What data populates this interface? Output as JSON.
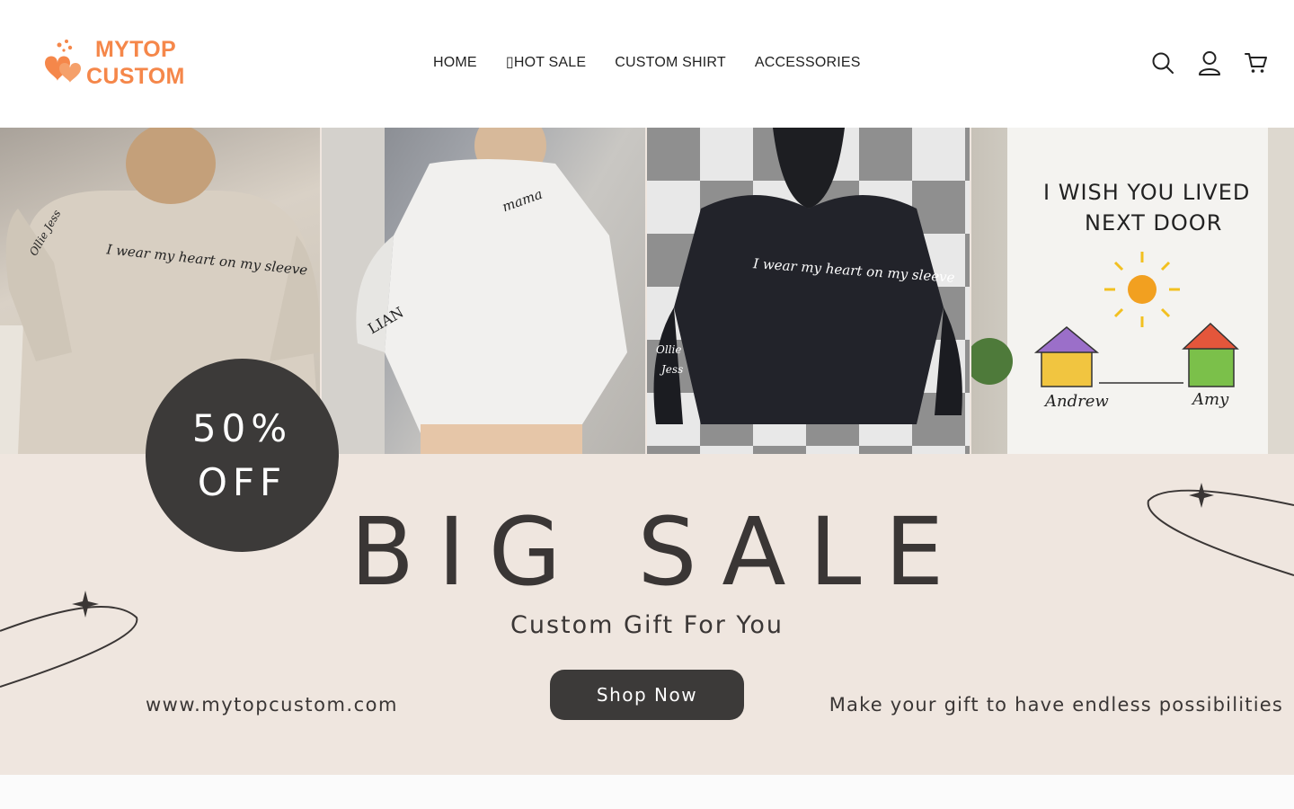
{
  "brand": {
    "line1": "MYTOP",
    "line2": "CUSTOM",
    "color": "#f5874a"
  },
  "nav": {
    "items": [
      {
        "label": "HOME"
      },
      {
        "label": "▯HOT SALE"
      },
      {
        "label": "CUSTOM SHIRT"
      },
      {
        "label": "ACCESSORIES"
      }
    ]
  },
  "header_icons": [
    "search-icon",
    "account-icon",
    "cart-icon"
  ],
  "banner": {
    "photos": {
      "p1_text": "I wear my heart on my sleeve",
      "p1_sleeve": "Ollie Jess",
      "p2_text": "mama",
      "p2_sleeve": "LIAN",
      "p3_text": "I wear my heart on my sleeve",
      "p3_sleeve1": "Ollie",
      "p3_sleeve2": "Jess",
      "p4_line1": "I WISH YOU LIVED",
      "p4_line2": "NEXT DOOR",
      "p4_name1": "Andrew",
      "p4_name2": "Amy"
    },
    "badge_line1": "50%",
    "badge_line2": "OFF",
    "headline": "BIG SALE",
    "subtitle": "Custom Gift For You",
    "cta": "Shop Now",
    "url": "www.mytopcustom.com",
    "tagline": "Make your gift to have endless possibilities",
    "bg_color": "#efe6df",
    "dark_color": "#3c3a39"
  }
}
